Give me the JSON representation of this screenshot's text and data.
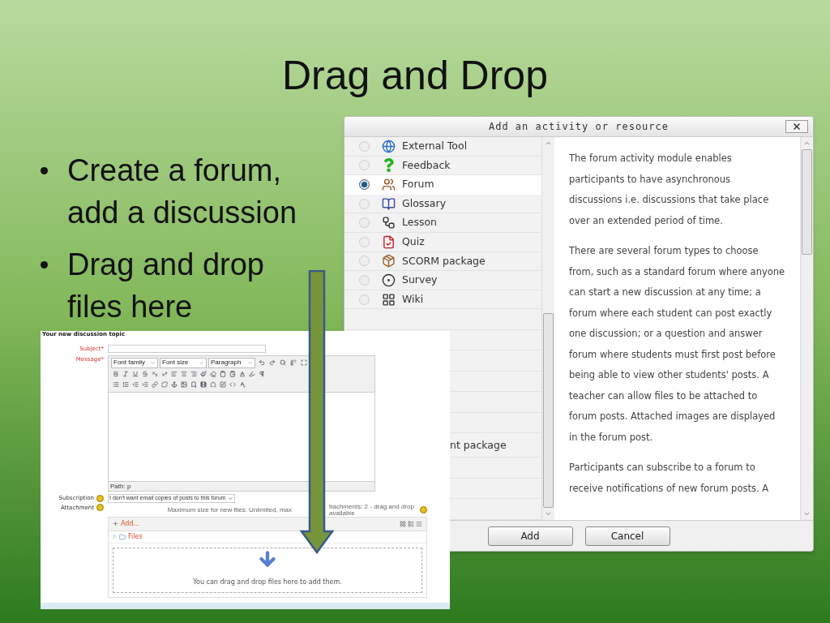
{
  "slide": {
    "title": "Drag and Drop",
    "bullets": [
      "Create a forum, add a discussion",
      "Drag and drop files here"
    ]
  },
  "dialog": {
    "title": "Add an activity or resource",
    "options": [
      {
        "label": "External Tool",
        "selected": false
      },
      {
        "label": "Feedback",
        "selected": false
      },
      {
        "label": "Forum",
        "selected": true
      },
      {
        "label": "Glossary",
        "selected": false
      },
      {
        "label": "Lesson",
        "selected": false
      },
      {
        "label": "Quiz",
        "selected": false
      },
      {
        "label": "SCORM package",
        "selected": false
      },
      {
        "label": "Survey",
        "selected": false
      },
      {
        "label": "Wiki",
        "selected": false
      }
    ],
    "partial_option": "nt package",
    "description": [
      "The forum activity module enables participants to have asynchronous discussions i.e. discussions that take place over an extended period of time.",
      "There are several forum types to choose from, such as a standard forum where anyone can start a new discussion at any time; a forum where each student can post exactly one discussion; or a question and answer forum where students must first post before being able to view other students' posts. A teacher can allow files to be attached to forum posts. Attached images are displayed in the forum post.",
      "Participants can subscribe to a forum to receive notifications of new forum posts. A"
    ],
    "buttons": [
      "Add",
      "Cancel"
    ]
  },
  "form": {
    "heading": "Your new discussion topic",
    "subject_label": "Subject*",
    "message_label": "Message*",
    "font_family": "Font family",
    "font_size": "Font size",
    "format": "Paragraph",
    "path": "Path: p",
    "subscription_label": "Subscription",
    "subscription_value": "I don't want email copies of posts to this forum",
    "attachment_label": "Attachment",
    "limits_left": "Maximum size for new files: Unlimited, max",
    "limits_right": "ttachments: 2 - drag and drop available",
    "add": "Add...",
    "files": "Files",
    "drop_hint": "You can drag and drop files here to add them."
  }
}
